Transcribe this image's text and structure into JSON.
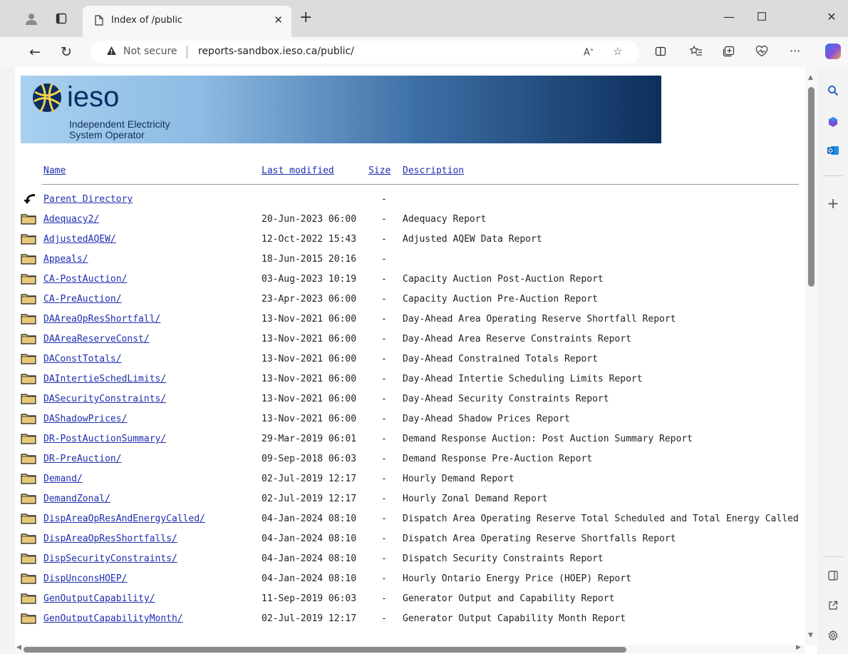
{
  "browser": {
    "tab_title": "Index of /public",
    "security_label": "Not secure",
    "url": "reports-sandbox.ieso.ca/public/"
  },
  "banner": {
    "logo_word": "ieso",
    "tagline_line1": "Independent Electricity",
    "tagline_line2": "System Operator"
  },
  "columns": {
    "name": "Name",
    "last_modified": "Last modified",
    "size": "Size",
    "description": "Description"
  },
  "entries": [
    {
      "name": "Parent Directory",
      "modified": "",
      "size": "-",
      "description": "",
      "icon": "parent-directory-icon"
    },
    {
      "name": "Adequacy2/",
      "modified": "20-Jun-2023 06:00",
      "size": "-",
      "description": "Adequacy Report",
      "icon": "folder-icon"
    },
    {
      "name": "AdjustedAQEW/",
      "modified": "12-Oct-2022 15:43",
      "size": "-",
      "description": "Adjusted AQEW Data Report",
      "icon": "folder-icon"
    },
    {
      "name": "Appeals/",
      "modified": "18-Jun-2015 20:16",
      "size": "-",
      "description": "",
      "icon": "folder-icon"
    },
    {
      "name": "CA-PostAuction/",
      "modified": "03-Aug-2023 10:19",
      "size": "-",
      "description": "Capacity Auction Post-Auction Report",
      "icon": "folder-icon"
    },
    {
      "name": "CA-PreAuction/",
      "modified": "23-Apr-2023 06:00",
      "size": "-",
      "description": "Capacity Auction Pre-Auction Report",
      "icon": "folder-icon"
    },
    {
      "name": "DAAreaOpResShortfall/",
      "modified": "13-Nov-2021 06:00",
      "size": "-",
      "description": "Day-Ahead Area Operating Reserve Shortfall Report",
      "icon": "folder-icon"
    },
    {
      "name": "DAAreaReserveConst/",
      "modified": "13-Nov-2021 06:00",
      "size": "-",
      "description": "Day-Ahead Area Reserve Constraints Report",
      "icon": "folder-icon"
    },
    {
      "name": "DAConstTotals/",
      "modified": "13-Nov-2021 06:00",
      "size": "-",
      "description": "Day-Ahead Constrained Totals Report",
      "icon": "folder-icon"
    },
    {
      "name": "DAIntertieSchedLimits/",
      "modified": "13-Nov-2021 06:00",
      "size": "-",
      "description": "Day-Ahead Intertie Scheduling Limits Report",
      "icon": "folder-icon"
    },
    {
      "name": "DASecurityConstraints/",
      "modified": "13-Nov-2021 06:00",
      "size": "-",
      "description": "Day-Ahead Security Constraints Report",
      "icon": "folder-icon"
    },
    {
      "name": "DAShadowPrices/",
      "modified": "13-Nov-2021 06:00",
      "size": "-",
      "description": "Day-Ahead Shadow Prices Report",
      "icon": "folder-icon"
    },
    {
      "name": "DR-PostAuctionSummary/",
      "modified": "29-Mar-2019 06:01",
      "size": "-",
      "description": "Demand Response Auction: Post Auction Summary Report",
      "icon": "folder-icon"
    },
    {
      "name": "DR-PreAuction/",
      "modified": "09-Sep-2018 06:03",
      "size": "-",
      "description": "Demand Response Pre-Auction Report",
      "icon": "folder-icon"
    },
    {
      "name": "Demand/",
      "modified": "02-Jul-2019 12:17",
      "size": "-",
      "description": "Hourly Demand Report",
      "icon": "folder-icon"
    },
    {
      "name": "DemandZonal/",
      "modified": "02-Jul-2019 12:17",
      "size": "-",
      "description": "Hourly Zonal Demand Report",
      "icon": "folder-icon"
    },
    {
      "name": "DispAreaOpResAndEnergyCalled/",
      "modified": "04-Jan-2024 08:10",
      "size": "-",
      "description": "Dispatch Area Operating Reserve Total Scheduled and Total Energy Called",
      "icon": "folder-icon"
    },
    {
      "name": "DispAreaOpResShortfalls/",
      "modified": "04-Jan-2024 08:10",
      "size": "-",
      "description": "Dispatch Area Operating Reserve Shortfalls Report",
      "icon": "folder-icon"
    },
    {
      "name": "DispSecurityConstraints/",
      "modified": "04-Jan-2024 08:10",
      "size": "-",
      "description": "Dispatch Security Constraints Report",
      "icon": "folder-icon"
    },
    {
      "name": "DispUnconsHOEP/",
      "modified": "04-Jan-2024 08:10",
      "size": "-",
      "description": "Hourly Ontario Energy Price (HOEP) Report",
      "icon": "folder-icon"
    },
    {
      "name": "GenOutputCapability/",
      "modified": "11-Sep-2019 06:03",
      "size": "-",
      "description": "Generator Output and Capability Report",
      "icon": "folder-icon"
    },
    {
      "name": "GenOutputCapabilityMonth/",
      "modified": "02-Jul-2019 12:17",
      "size": "-",
      "description": "Generator Output Capability Month Report",
      "icon": "folder-icon"
    }
  ],
  "colors": {
    "link": "#1f2fb0",
    "banner_dark": "#0d2f5c",
    "folder": "#e9c77a"
  }
}
